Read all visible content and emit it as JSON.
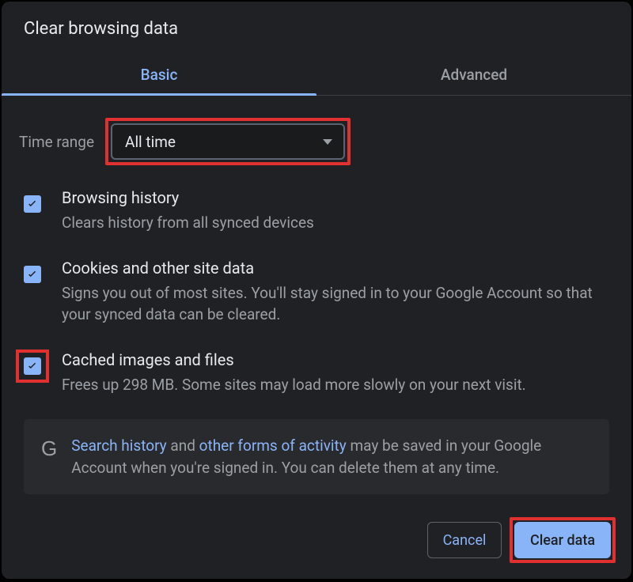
{
  "dialog": {
    "title": "Clear browsing data",
    "tabs": {
      "basic": "Basic",
      "advanced": "Advanced"
    },
    "timeRange": {
      "label": "Time range",
      "value": "All time"
    },
    "options": [
      {
        "title": "Browsing history",
        "desc": "Clears history from all synced devices"
      },
      {
        "title": "Cookies and other site data",
        "desc": "Signs you out of most sites. You'll stay signed in to your Google Account so that your synced data can be cleared."
      },
      {
        "title": "Cached images and files",
        "desc": "Frees up 298 MB. Some sites may load more slowly on your next visit."
      }
    ],
    "info": {
      "link1": "Search history",
      "mid1": " and ",
      "link2": "other forms of activity",
      "rest": " may be saved in your Google Account when you're signed in. You can delete them at any time."
    },
    "buttons": {
      "cancel": "Cancel",
      "clear": "Clear data"
    }
  }
}
